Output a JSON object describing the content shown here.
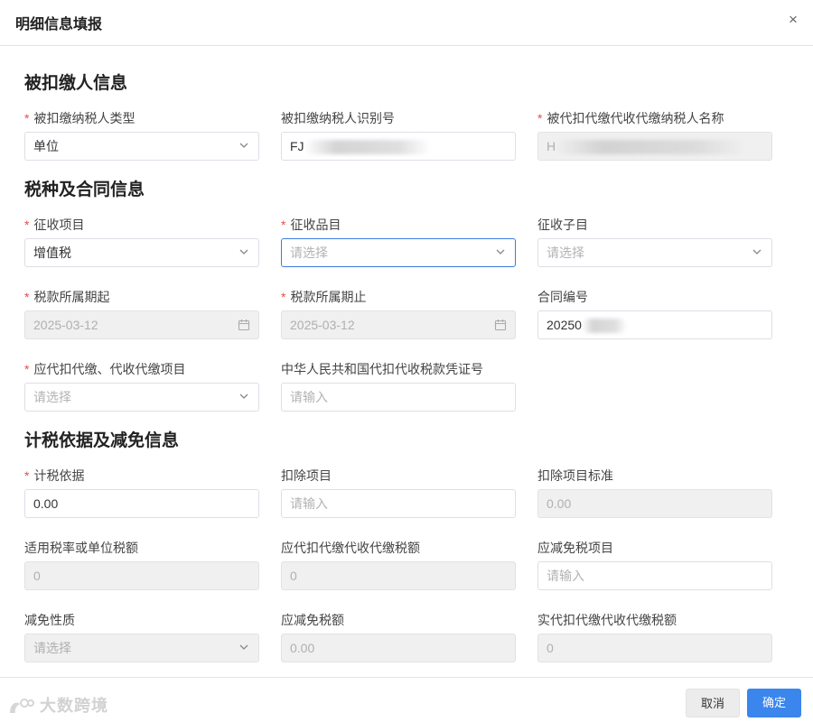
{
  "dialog": {
    "title": "明细信息填报",
    "close_glyph": "×"
  },
  "sections": {
    "payer": "被扣缴人信息",
    "tax": "税种及合同信息",
    "basis": "计税依据及减免信息"
  },
  "required_mark": "*",
  "fields": {
    "payer_type": {
      "label": "被扣缴纳税人类型",
      "value": "单位"
    },
    "payer_id": {
      "label": "被扣缴纳税人识别号",
      "value": "FJ"
    },
    "payer_name": {
      "label": "被代扣代缴代收代缴纳税人名称",
      "value": "H"
    },
    "collect_item": {
      "label": "征收项目",
      "value": "增值税"
    },
    "collect_category": {
      "label": "征收品目",
      "placeholder": "请选择"
    },
    "collect_sub": {
      "label": "征收子目",
      "placeholder": "请选择"
    },
    "period_start": {
      "label": "税款所属期起",
      "value": "2025-03-12"
    },
    "period_end": {
      "label": "税款所属期止",
      "value": "2025-03-12"
    },
    "contract_no": {
      "label": "合同编号",
      "value": "20250"
    },
    "withhold_item": {
      "label": "应代扣代缴、代收代缴项目",
      "placeholder": "请选择"
    },
    "voucher_no": {
      "label": "中华人民共和国代扣代收税款凭证号",
      "placeholder": "请输入"
    },
    "tax_basis": {
      "label": "计税依据",
      "value": "0.00"
    },
    "deduct_item": {
      "label": "扣除项目",
      "placeholder": "请输入"
    },
    "deduct_standard": {
      "label": "扣除项目标准",
      "value": "0.00"
    },
    "tax_rate": {
      "label": "适用税率或单位税额",
      "value": "0"
    },
    "should_withhold": {
      "label": "应代扣代缴代收代缴税额",
      "value": "0"
    },
    "exempt_item": {
      "label": "应减免税项目",
      "placeholder": "请输入"
    },
    "exempt_nature": {
      "label": "减免性质",
      "placeholder": "请选择"
    },
    "exempt_amount": {
      "label": "应减免税额",
      "value": "0.00"
    },
    "actual_withhold": {
      "label": "实代扣代缴代收代缴税额",
      "value": "0"
    }
  },
  "footer": {
    "cancel_label": "取消",
    "ok_label": "确定"
  },
  "watermark": {
    "text": "大数跨境"
  },
  "colors": {
    "primary": "#3a86ec",
    "required": "#e0524a",
    "disabled_bg": "#f0f0f0"
  }
}
